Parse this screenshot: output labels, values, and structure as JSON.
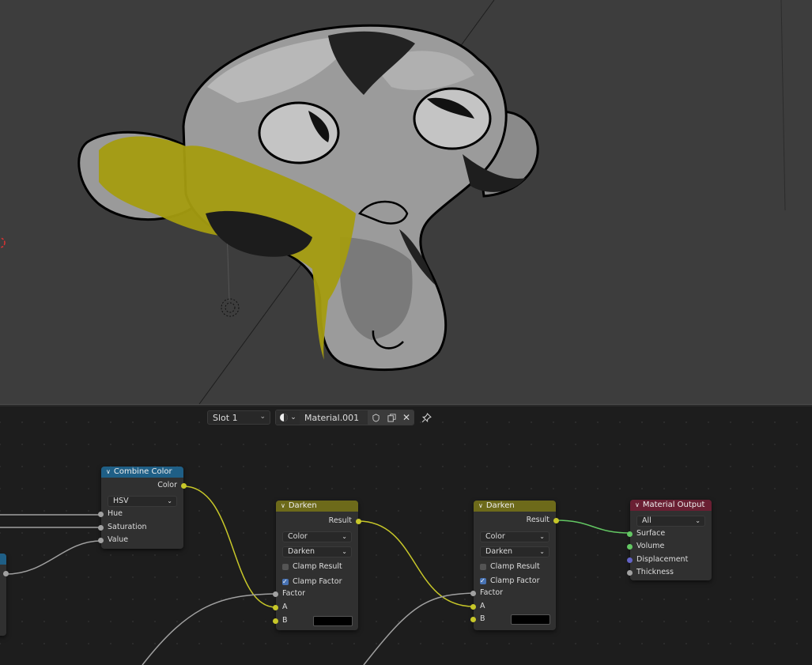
{
  "header": {
    "slot": "Slot 1",
    "material_name": "Material.001"
  },
  "nodes": {
    "combine_color": {
      "title": "Combine Color",
      "output": "Color",
      "mode": "HSV",
      "inputs": [
        "Hue",
        "Saturation",
        "Value"
      ]
    },
    "darken1": {
      "title": "Darken",
      "output": "Result",
      "data_type": "Color",
      "blend": "Darken",
      "clamp_result": {
        "label": "Clamp Result",
        "checked": false
      },
      "clamp_factor": {
        "label": "Clamp Factor",
        "checked": true
      },
      "inputs": [
        "Factor",
        "A",
        "B"
      ]
    },
    "darken2": {
      "title": "Darken",
      "output": "Result",
      "data_type": "Color",
      "blend": "Darken",
      "clamp_result": {
        "label": "Clamp Result",
        "checked": false
      },
      "clamp_factor": {
        "label": "Clamp Factor",
        "checked": true
      },
      "inputs": [
        "Factor",
        "A",
        "B"
      ]
    },
    "material_output": {
      "title": "Material Output",
      "target": "All",
      "inputs": [
        "Surface",
        "Volume",
        "Displacement",
        "Thickness"
      ]
    }
  },
  "colors": {
    "viewport_bg": "#3d3d3d",
    "editor_bg": "#1d1d1d",
    "header_converter": "#1f5f86",
    "header_darken": "#6d6a1a",
    "header_output": "#6a1f33",
    "socket_color": "#c7c729",
    "socket_float": "#a1a1a1",
    "socket_shader": "#63c763",
    "socket_vector": "#6363c7",
    "accent": "#4772b3"
  }
}
